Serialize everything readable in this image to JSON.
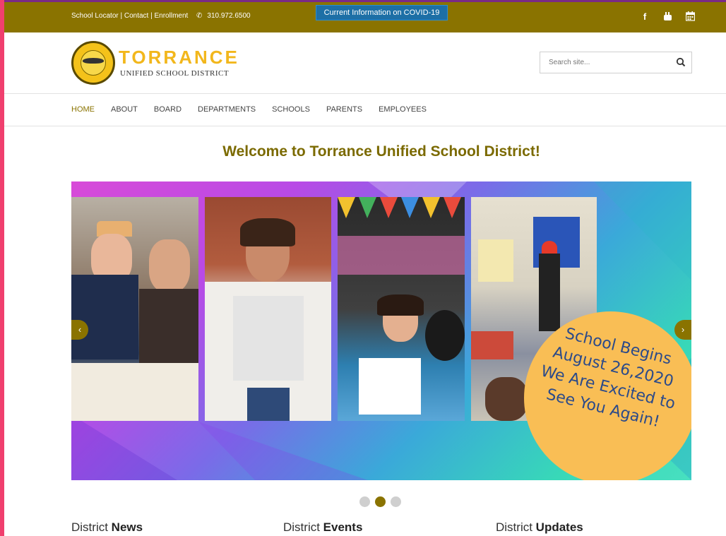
{
  "topbar": {
    "links": [
      "School Locator",
      "Contact",
      "Enrollment"
    ],
    "separator": " | ",
    "phone": "310.972.6500",
    "covid_button": "Current Information on COVID-19",
    "social": [
      "facebook-icon",
      "youtube-icon",
      "calendar-icon"
    ]
  },
  "header": {
    "logo_title": "TORRANCE",
    "logo_subtitle": "UNIFIED SCHOOL DISTRICT",
    "search_placeholder": "Search site..."
  },
  "nav": {
    "items": [
      "HOME",
      "ABOUT",
      "BOARD",
      "DEPARTMENTS",
      "SCHOOLS",
      "PARENTS",
      "EMPLOYEES"
    ],
    "active": "HOME"
  },
  "main": {
    "welcome": "Welcome to Torrance Unified School District!"
  },
  "slider": {
    "banner_lines": [
      "School Begins",
      "August 26,2020",
      "We Are Excited to",
      "See You Again!"
    ],
    "prev_label": "‹",
    "next_label": "›",
    "slide_count": 3,
    "active_slide": 2
  },
  "columns": [
    {
      "prefix": "District ",
      "bold": "News"
    },
    {
      "prefix": "District ",
      "bold": "Events"
    },
    {
      "prefix": "District ",
      "bold": "Updates"
    }
  ],
  "colors": {
    "brand_olive": "#8a7300",
    "covid_blue": "#1d6fa6",
    "logo_gold": "#f2b71c",
    "banner_yellow": "#f9be55",
    "banner_text": "#2b4a8a"
  }
}
